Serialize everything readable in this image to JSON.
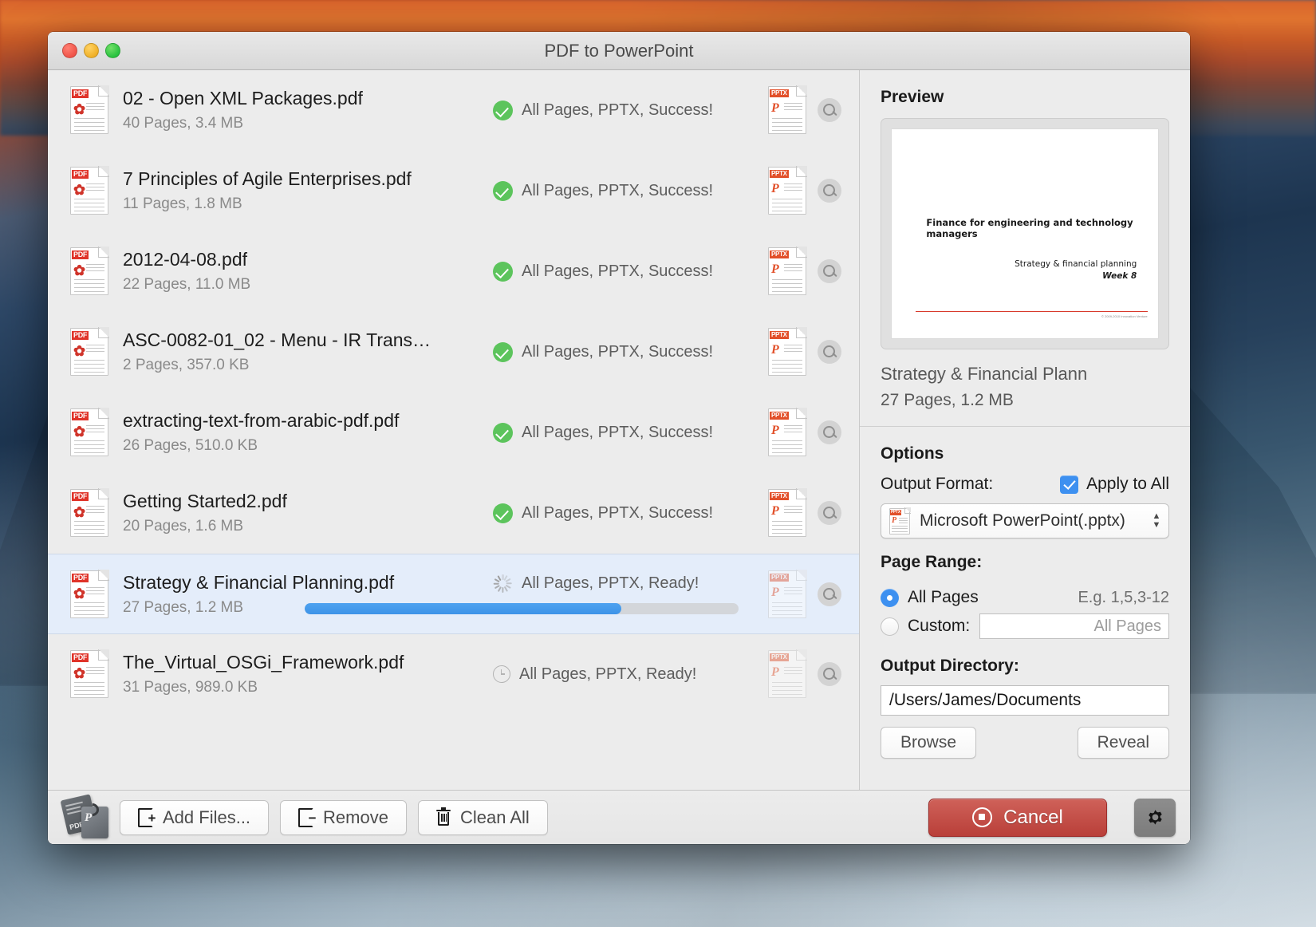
{
  "window": {
    "title": "PDF to PowerPoint",
    "traffic_lights": [
      "close",
      "minimize",
      "zoom"
    ]
  },
  "filelist": {
    "rows": [
      {
        "name": "02 - Open XML Packages.pdf",
        "meta": "40 Pages, 3.4 MB",
        "status": "All Pages, PPTX, Success!",
        "state": "success"
      },
      {
        "name": "7 Principles of Agile Enterprises.pdf",
        "meta": "11 Pages, 1.8 MB",
        "status": "All Pages, PPTX, Success!",
        "state": "success"
      },
      {
        "name": "2012-04-08.pdf",
        "meta": "22 Pages, 11.0 MB",
        "status": "All Pages, PPTX, Success!",
        "state": "success"
      },
      {
        "name": "ASC-0082-01_02 - Menu - IR Trans…",
        "meta": "2 Pages, 357.0 KB",
        "status": "All Pages, PPTX, Success!",
        "state": "success"
      },
      {
        "name": "extracting-text-from-arabic-pdf.pdf",
        "meta": "26 Pages, 510.0 KB",
        "status": "All Pages, PPTX, Success!",
        "state": "success"
      },
      {
        "name": "Getting Started2.pdf",
        "meta": "20 Pages, 1.6 MB",
        "status": "All Pages, PPTX, Success!",
        "state": "success"
      },
      {
        "name": "Strategy & Financial Planning.pdf",
        "meta": "27 Pages, 1.2 MB",
        "status": "All Pages, PPTX, Ready!",
        "state": "converting",
        "selected": true,
        "progress_percent": 73
      },
      {
        "name": "The_Virtual_OSGi_Framework.pdf",
        "meta": "31 Pages, 989.0 KB",
        "status": "All Pages, PPTX, Ready!",
        "state": "queued"
      }
    ],
    "source_badge": "PDF",
    "output_badge": "PPTX",
    "output_glyph": "P"
  },
  "preview": {
    "heading": "Preview",
    "slide": {
      "title": "Finance for engineering and technology managers",
      "subtitle": "Strategy & financial planning",
      "week": "Week 8",
      "copyright": "© 2009-2010 Innovation Venture"
    },
    "file_name": "Strategy & Financial Plann",
    "file_meta": "27 Pages, 1.2 MB"
  },
  "options": {
    "heading": "Options",
    "output_format_label": "Output Format:",
    "apply_to_all_label": "Apply to All",
    "apply_to_all_checked": true,
    "format_value": "Microsoft PowerPoint(.pptx)",
    "page_range_label": "Page Range:",
    "all_pages_label": "All Pages",
    "all_pages_selected": true,
    "custom_label": "Custom:",
    "custom_selected": false,
    "custom_placeholder": "All Pages",
    "example_hint": "E.g. 1,5,3-12",
    "output_dir_label": "Output Directory:",
    "output_dir_value": "/Users/James/Documents",
    "browse_label": "Browse",
    "reveal_label": "Reveal"
  },
  "toolbar": {
    "add_files_label": "Add Files...",
    "remove_label": "Remove",
    "clean_all_label": "Clean All",
    "cancel_label": "Cancel",
    "settings_icon": "gear-icon"
  },
  "colors": {
    "accent_blue": "#3d90f0",
    "success_green": "#5cc45c",
    "cancel_red": "#b93f39",
    "pdf_red": "#e0342a",
    "pptx_orange": "#e2502a"
  }
}
